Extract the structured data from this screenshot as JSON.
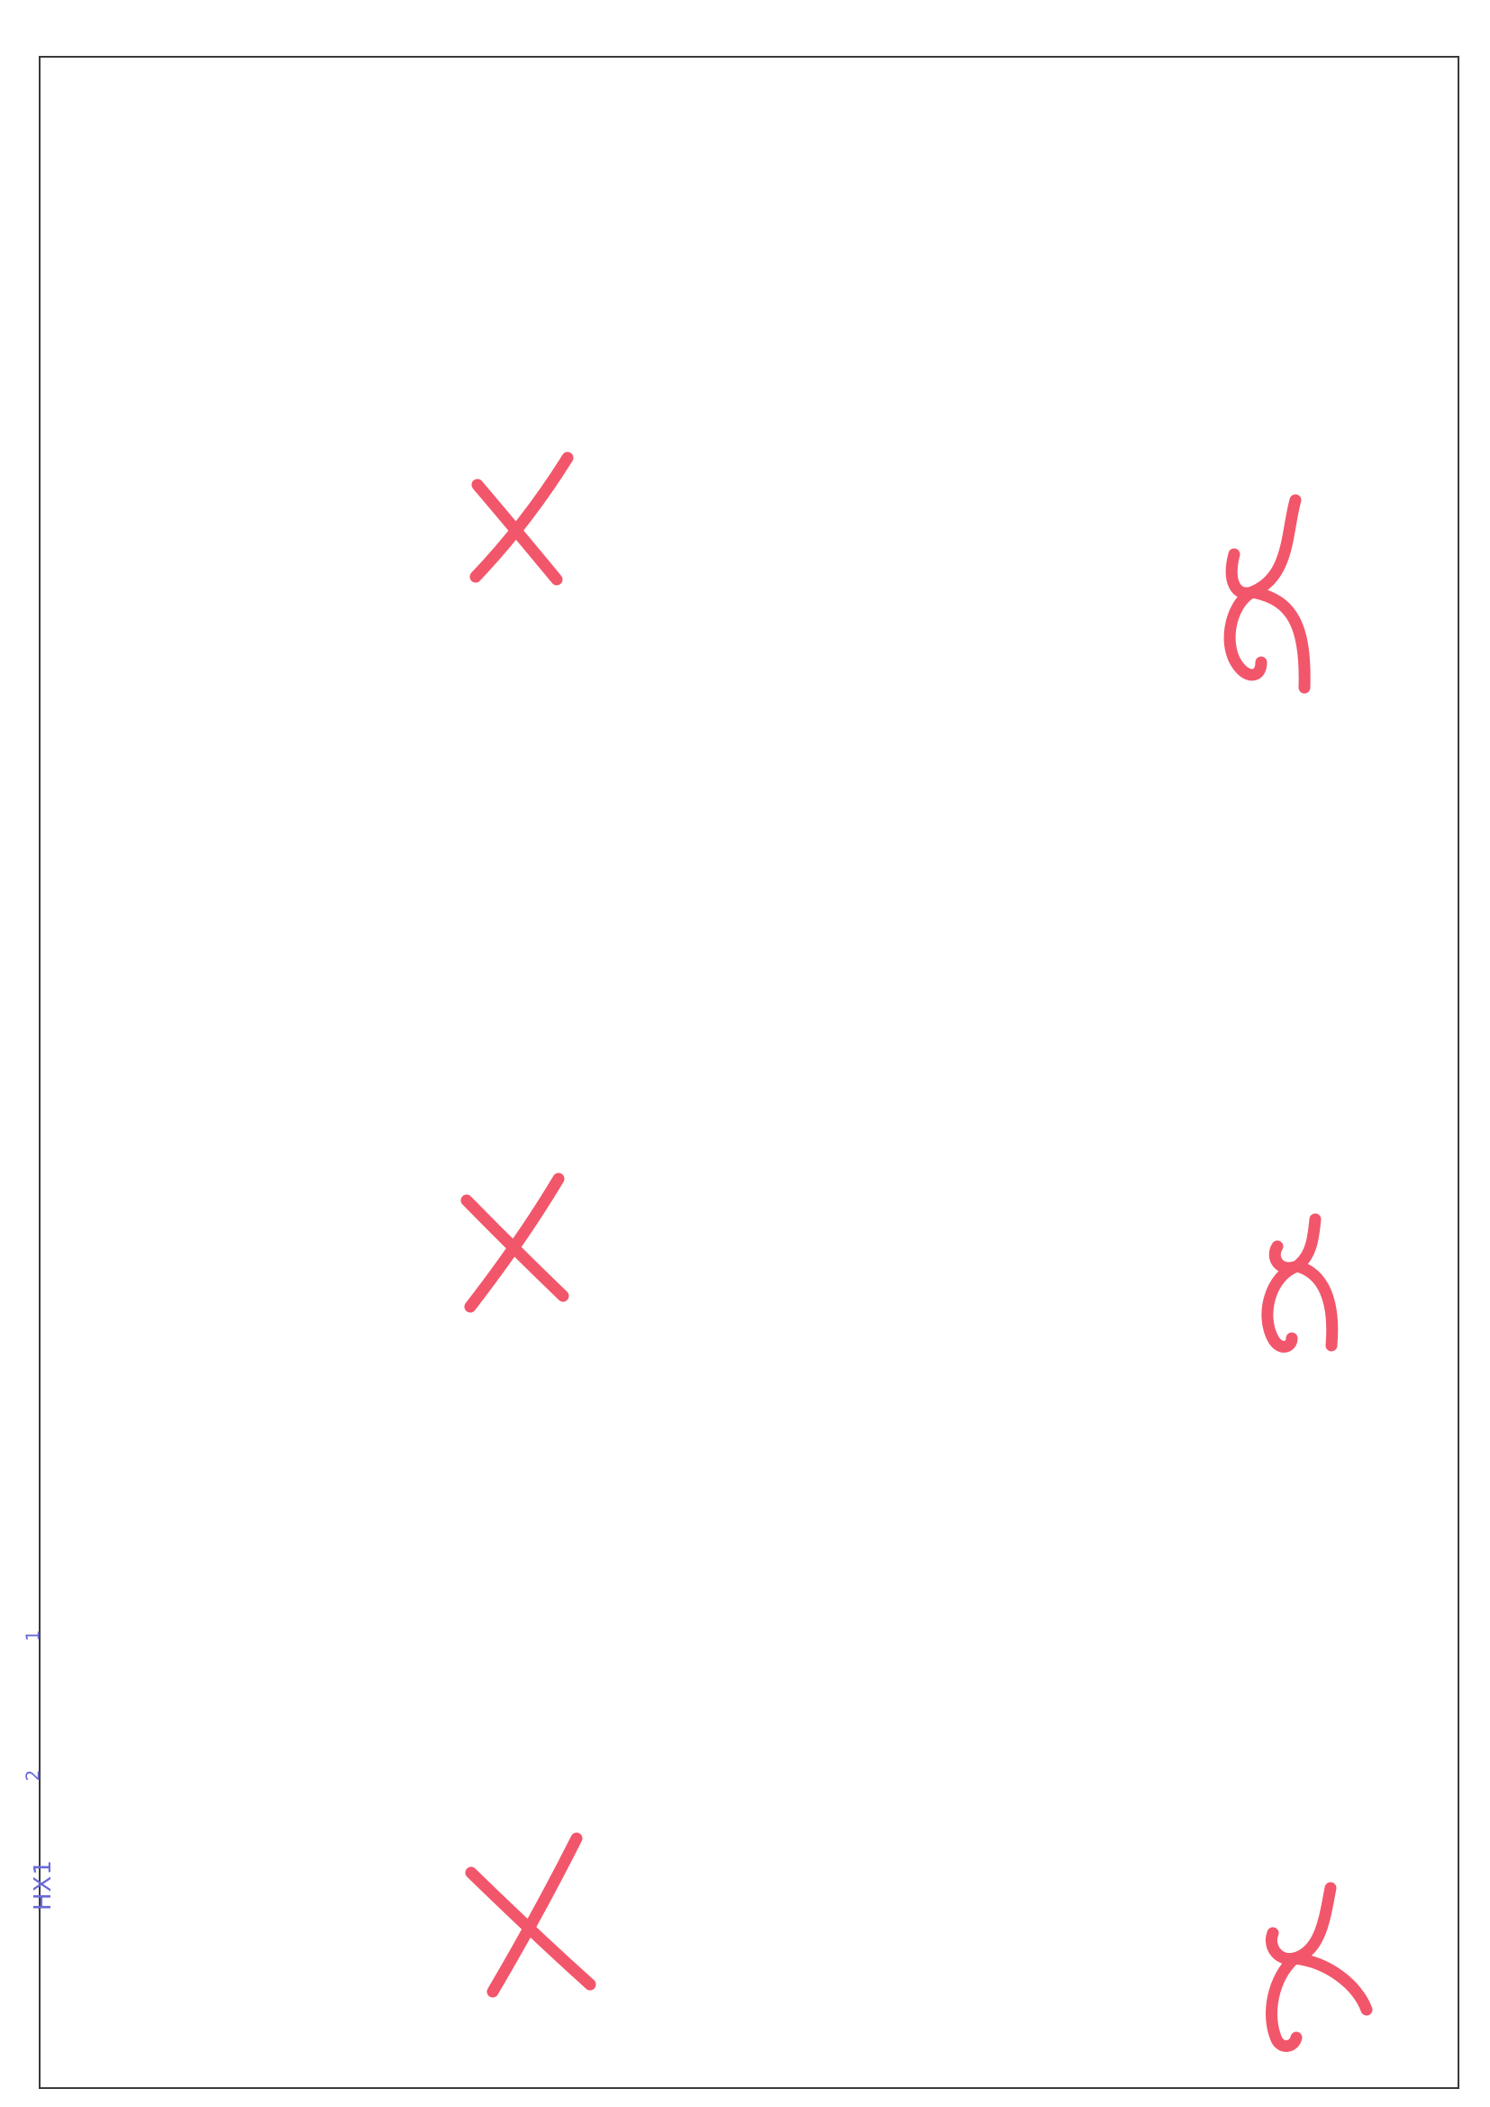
{
  "page": {
    "border_color": "#3a3a3a",
    "mark_color": "#f2566b",
    "annotation_color": "#6a6ad8"
  },
  "marks": [
    {
      "row": 1,
      "column": 1,
      "glyph": "X"
    },
    {
      "row": 1,
      "column": 2,
      "glyph": "x"
    },
    {
      "row": 2,
      "column": 1,
      "glyph": "X"
    },
    {
      "row": 2,
      "column": 2,
      "glyph": "x"
    },
    {
      "row": 3,
      "column": 1,
      "glyph": "X"
    },
    {
      "row": 3,
      "column": 2,
      "glyph": "x"
    }
  ],
  "margin": {
    "code": "HX1",
    "tick_1": "2",
    "tick_2": "1"
  }
}
